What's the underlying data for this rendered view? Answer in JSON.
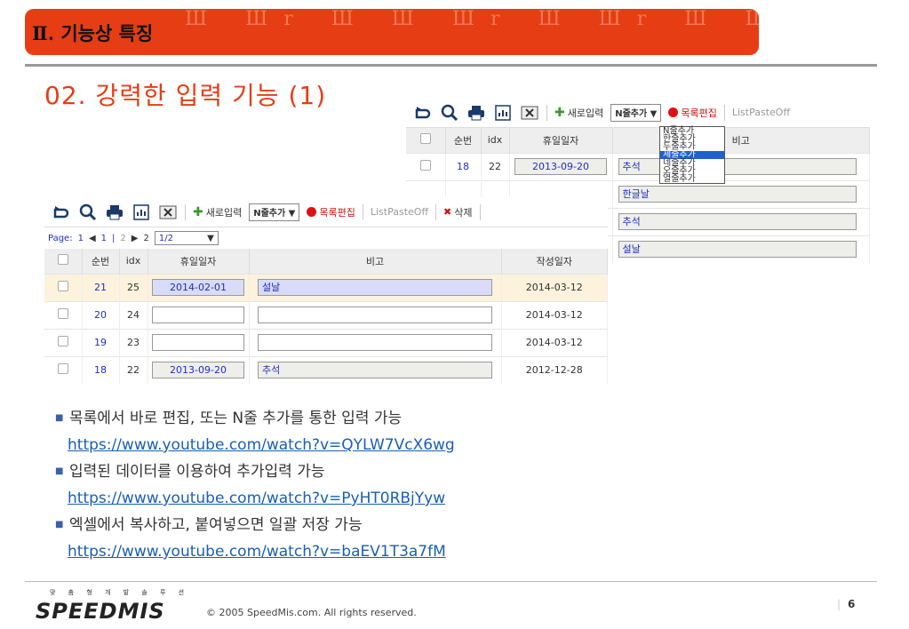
{
  "banner": {
    "title": "Ⅱ. 기능상 특징",
    "decor": "Ш Шr Ш  Ш Шr Ш Шr Ш Шr Ш  Шr"
  },
  "heading": "02. 강력한 입력 기능 (1)",
  "back_panel": {
    "toolbar": {
      "new_input": "새로입력",
      "select_value": "N줄추가 ▼",
      "edit_list": "목록편집",
      "list_paste": "ListPasteOff"
    },
    "columns": [
      "순번",
      "idx",
      "휴일일자",
      "비고"
    ],
    "rows": [
      {
        "seq": "18",
        "idx": "22",
        "date": "2013-09-20",
        "note": "추석"
      },
      {
        "seq": "",
        "idx": "",
        "date": "",
        "note": "한글날"
      },
      {
        "seq": "",
        "idx": "",
        "date": "",
        "note": "추석"
      },
      {
        "seq": "",
        "idx": "",
        "date": "",
        "note": "설날"
      }
    ],
    "dropdown_options": [
      "N줄추가",
      "한줄추가",
      "두줄추가",
      "세줄추가",
      "네줄추가",
      "오줄추가",
      "열줄추가"
    ],
    "dropdown_selected_index": 3
  },
  "front_panel": {
    "toolbar": {
      "new_input": "새로입력",
      "select_value": "N줄추가 ▼",
      "edit_list": "목록편집",
      "list_paste": "ListPasteOff",
      "delete": "삭제"
    },
    "pager": {
      "label": "Page:",
      "first": "1",
      "current": "1",
      "sep": "|",
      "next": "2",
      "last": "2",
      "select": "1/2"
    },
    "columns": [
      "순번",
      "idx",
      "휴일일자",
      "비고",
      "작성일자"
    ],
    "rows": [
      {
        "seq": "21",
        "idx": "25",
        "date": "2014-02-01",
        "note": "설날",
        "created": "2014-03-12",
        "highlight": true,
        "filled": true
      },
      {
        "seq": "20",
        "idx": "24",
        "date": "",
        "note": "",
        "created": "2014-03-12",
        "highlight": false,
        "filled": false
      },
      {
        "seq": "19",
        "idx": "23",
        "date": "",
        "note": "",
        "created": "2014-03-12",
        "highlight": false,
        "filled": false
      },
      {
        "seq": "18",
        "idx": "22",
        "date": "2013-09-20",
        "note": "추석",
        "created": "2012-12-28",
        "highlight": false,
        "filled": true
      }
    ]
  },
  "bullets": [
    {
      "text": "목록에서 바로 편집, 또는 N줄 추가를 통한 입력 가능",
      "link": "https://www.youtube.com/watch?v=QYLW7VcX6wg"
    },
    {
      "text": "입력된 데이터를 이용하여 추가입력 가능",
      "link": "https://www.youtube.com/watch?v=PyHT0RBjYyw"
    },
    {
      "text": "엑셀에서 복사하고, 붙여넣으면 일괄 저장 가능",
      "link": "https://www.youtube.com/watch?v=baEV1T3a7fM"
    }
  ],
  "footer": {
    "logo_small": "맞 춤 형 개 발 솔 루 션",
    "logo": "SPEEDMIS",
    "copyright": "© 2005 SpeedMis.com. All rights reserved.",
    "page_sep": "|",
    "page_number": "6"
  },
  "colors": {
    "accent": "#e63d14",
    "link": "#1a5fb4"
  },
  "icons": [
    "refresh-icon",
    "search-icon",
    "print-icon",
    "chart-icon",
    "excel-icon",
    "plus-icon",
    "red-dot-icon",
    "delete-x-icon",
    "checkbox-icon"
  ]
}
